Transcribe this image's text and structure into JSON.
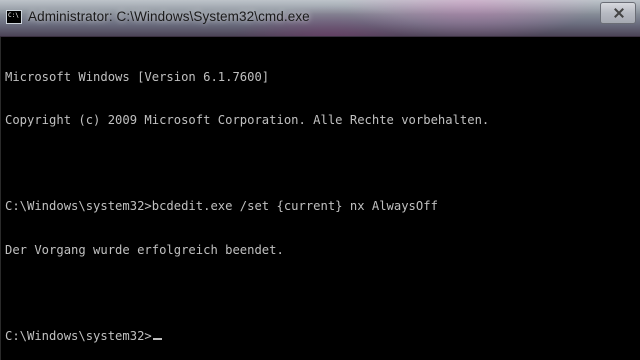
{
  "window": {
    "title": "Administrator: C:\\Windows\\System32\\cmd.exe",
    "icon_label": "C:\\",
    "icon": "cmd-icon",
    "close_icon": "close-icon"
  },
  "console": {
    "lines": [
      "Microsoft Windows [Version 6.1.7600]",
      "Copyright (c) 2009 Microsoft Corporation. Alle Rechte vorbehalten.",
      "",
      "C:\\Windows\\system32>bcdedit.exe /set {current} nx AlwaysOff",
      "Der Vorgang wurde erfolgreich beendet.",
      "",
      "C:\\Windows\\system32>"
    ],
    "text_color": "#c0c0c0",
    "background_color": "#000000"
  }
}
